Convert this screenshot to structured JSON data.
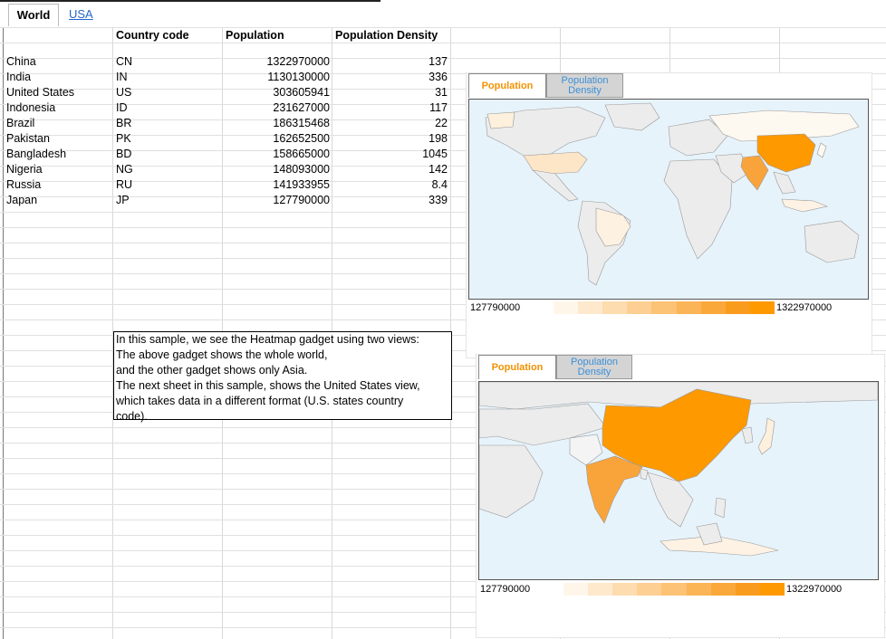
{
  "tabs": [
    {
      "label": "World"
    },
    {
      "label": "USA"
    }
  ],
  "table": {
    "headers": [
      "Country code",
      "Population",
      "Population Density"
    ],
    "rows": [
      {
        "country": "China",
        "code": "CN",
        "population": "1322970000",
        "density": "137"
      },
      {
        "country": "India",
        "code": "IN",
        "population": "1130130000",
        "density": "336"
      },
      {
        "country": "United States",
        "code": "US",
        "population": "303605941",
        "density": "31"
      },
      {
        "country": "Indonesia",
        "code": "ID",
        "population": "231627000",
        "density": "117"
      },
      {
        "country": "Brazil",
        "code": "BR",
        "population": "186315468",
        "density": "22"
      },
      {
        "country": "Pakistan",
        "code": "PK",
        "population": "162652500",
        "density": "198"
      },
      {
        "country": "Bangladesh",
        "code": "BD",
        "population": "158665000",
        "density": "1045"
      },
      {
        "country": "Nigeria",
        "code": "NG",
        "population": "148093000",
        "density": "142"
      },
      {
        "country": "Russia",
        "code": "RU",
        "population": "141933955",
        "density": "8.4"
      },
      {
        "country": "Japan",
        "code": "JP",
        "population": "127790000",
        "density": "339"
      }
    ]
  },
  "note": {
    "lines": [
      "In this sample, we see the Heatmap gadget using two views:",
      "The above gadget shows the whole world,",
      "and the other gadget shows only Asia.",
      "The next sheet in this sample, shows the United States view,",
      "which takes data in a different format (U.S. states country",
      "code)."
    ]
  },
  "gadget_world": {
    "tab_active": "Population",
    "tab_inactive_line1": "Population",
    "tab_inactive_line2": "Density",
    "legend_min": "127790000",
    "legend_max": "1322970000"
  },
  "gadget_asia": {
    "tab_active": "Population",
    "tab_inactive_line1": "Population",
    "tab_inactive_line2": "Density",
    "legend_min": "127790000",
    "legend_max": "1322970000"
  },
  "colors": {
    "high": "#ff9900",
    "mid": "#f9a43a",
    "low": "#fde6c8",
    "land": "#ececec",
    "water": "#e7f3fb",
    "tab_active_text": "#f29200",
    "tab_inactive_text": "#3d8fd6"
  }
}
